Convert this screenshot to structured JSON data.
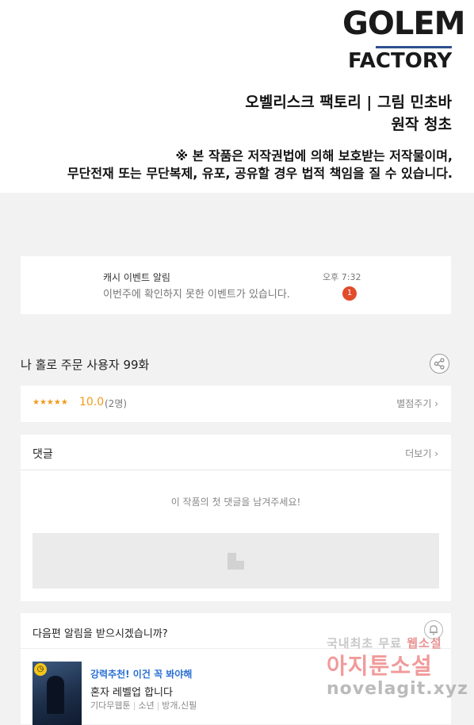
{
  "header": {
    "logo_line1": "GOLEM",
    "logo_line2": "FACTORY",
    "credit_line1": "오벨리스크 팩토리  |  그림 민초바",
    "credit_line2": "원작 청초",
    "notice_line1": "※ 본 작품은 저작권법에 의해 보호받는 저작물이며,",
    "notice_line2": "무단전재 또는 무단복제, 유포, 공유할 경우 법적 책임을 질 수 있습니다."
  },
  "notification": {
    "title": "캐시 이벤트 알림",
    "message": "이번주에 확인하지 못한 이벤트가 있습니다.",
    "time": "오후 7:32",
    "badge_count": "1",
    "badge_color": "#e24b2b"
  },
  "episode": {
    "title": "나 홀로 주문 사용자 99화",
    "share_icon": "share-icon"
  },
  "rating": {
    "stars": "★★★★★",
    "score": "10.0",
    "count": "(2명)",
    "rate_button": "별점주기 ›",
    "accent_color": "#f19a1a"
  },
  "comments": {
    "header": "댓글",
    "more": "더보기 ›",
    "empty_text": "이 작품의 첫 댓글을 남겨주세요!"
  },
  "subscribe": {
    "question": "다음편 알림을 받으시겠습니까?",
    "bell_icon": "bell-icon",
    "recommend_label": "강력추천! 이건 꼭 봐야해",
    "work_title": "혼자 레벨업 합니다",
    "meta": [
      "기다무웹툰",
      "소년",
      "방개,신필"
    ],
    "accent_color": "#2a6fd4"
  },
  "watermark": {
    "line1_a": "국내최초 무료 ",
    "line1_b": "웹소설",
    "line2": "아지툰소설",
    "line3": "novelagit.xyz"
  }
}
